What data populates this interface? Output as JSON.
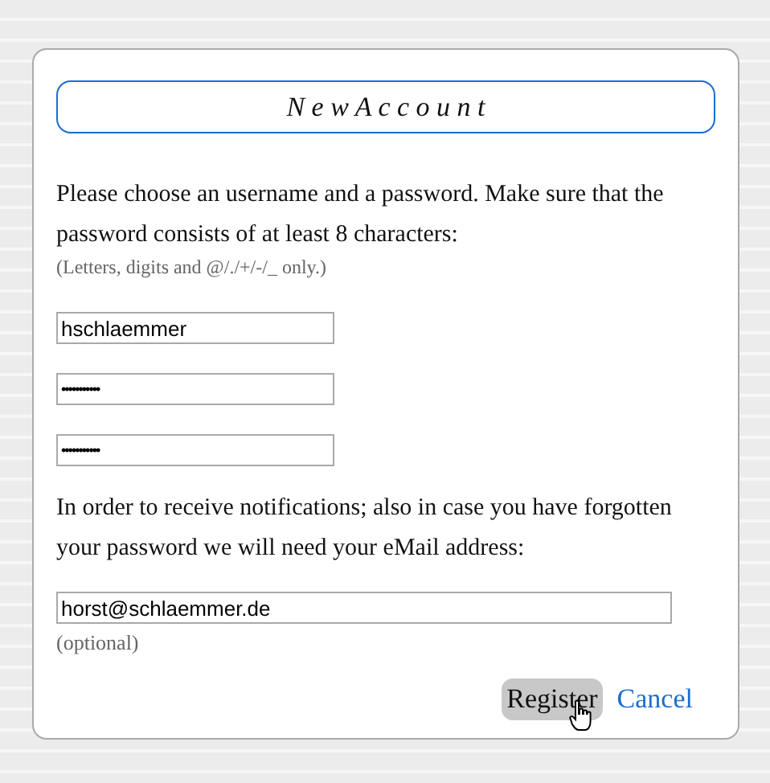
{
  "title": "N e w A c c o u n t",
  "intro": "Please choose an username and a password. Make sure that the password consists of at least 8 characters:",
  "hint": "(Letters, digits and @/./+/-/_ only.)",
  "fields": [
    {
      "kind": "username",
      "value": "hschlaemmer"
    },
    {
      "kind": "password",
      "value": "•••••••••••"
    },
    {
      "kind": "password",
      "value": "•••••••••••"
    }
  ],
  "email_text": "In order to receive notifications; also in case you have forgotten your password we will need your eMail address:",
  "email": {
    "value": "horst@schlaemmer.de"
  },
  "email_note": "(optional)",
  "buttons": [
    {
      "label": "Register",
      "kind": "button"
    },
    {
      "label": "Cancel",
      "kind": "link"
    }
  ]
}
